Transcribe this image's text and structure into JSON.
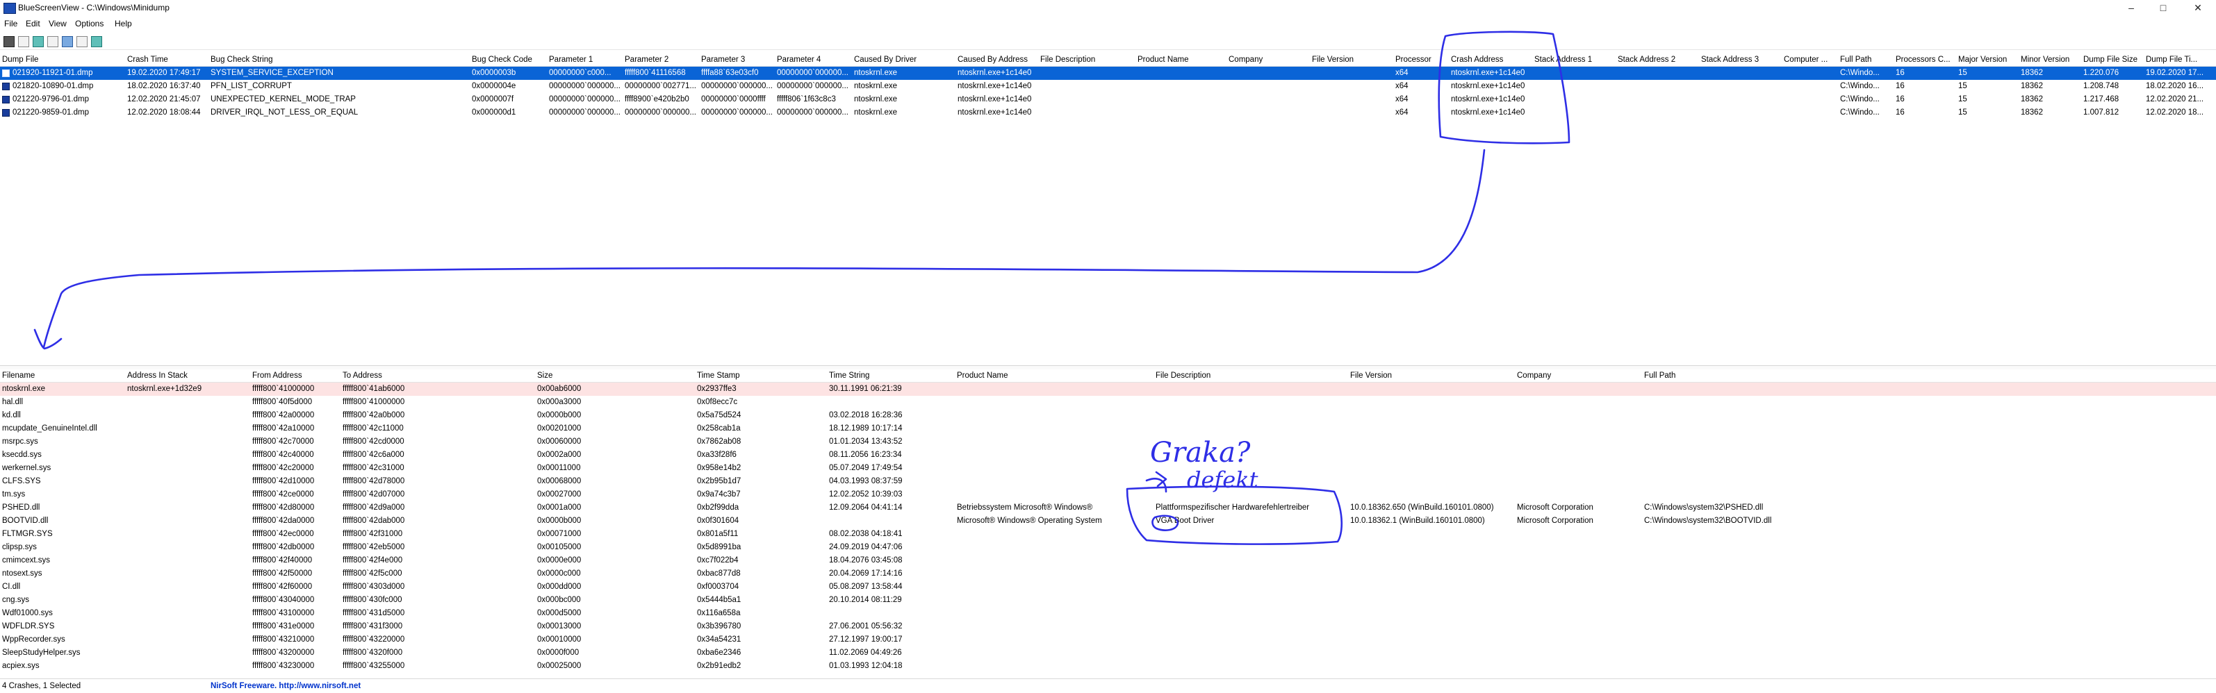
{
  "window": {
    "title": "BlueScreenView  -  C:\\Windows\\Minidump",
    "app_icon": "bluescreen-app-icon"
  },
  "menu": [
    "File",
    "Edit",
    "View",
    "Options",
    "Help"
  ],
  "toolbar_icons": [
    "save-icon",
    "properties-icon",
    "refresh-icon",
    "copy-icon",
    "html-report-icon",
    "find-icon",
    "exit-icon"
  ],
  "crash_table": {
    "headers": [
      "Dump File",
      "Crash Time",
      "Bug Check String",
      "Bug Check Code",
      "Parameter 1",
      "Parameter 2",
      "Parameter 3",
      "Parameter 4",
      "Caused By Driver",
      "Caused By Address",
      "File Description",
      "Product Name",
      "Company",
      "File Version",
      "Processor",
      "Crash Address",
      "Stack Address 1",
      "Stack Address 2",
      "Stack Address 3",
      "Computer ...",
      "Full Path",
      "Processors C...",
      "Major Version",
      "Minor Version",
      "Dump File Size",
      "Dump File Ti..."
    ],
    "rows": [
      [
        "021920-11921-01.dmp",
        "19.02.2020 17:49:17",
        "SYSTEM_SERVICE_EXCEPTION",
        "0x0000003b",
        "00000000`c000...",
        "fffff800`41116568",
        "ffffa88`63e03cf0",
        "00000000`000000...",
        "ntoskrnl.exe",
        "ntoskrnl.exe+1c14e0",
        "",
        "",
        "",
        "",
        "x64",
        "ntoskrnl.exe+1c14e0",
        "",
        "",
        "",
        "",
        "C:\\Windo...",
        "16",
        "15",
        "18362",
        "1.220.076",
        "19.02.2020 17..."
      ],
      [
        "021820-10890-01.dmp",
        "18.02.2020 16:37:40",
        "PFN_LIST_CORRUPT",
        "0x0000004e",
        "00000000`000000...",
        "00000000`002771...",
        "00000000`000000...",
        "00000000`000000...",
        "ntoskrnl.exe",
        "ntoskrnl.exe+1c14e0",
        "",
        "",
        "",
        "",
        "x64",
        "ntoskrnl.exe+1c14e0",
        "",
        "",
        "",
        "",
        "C:\\Windo...",
        "16",
        "15",
        "18362",
        "1.208.748",
        "18.02.2020 16..."
      ],
      [
        "021220-9796-01.dmp",
        "12.02.2020 21:45:07",
        "UNEXPECTED_KERNEL_MODE_TRAP",
        "0x0000007f",
        "00000000`000000...",
        "ffff8900`e420b2b0",
        "00000000`0000ffff",
        "fffff806`1f63c8c3",
        "ntoskrnl.exe",
        "ntoskrnl.exe+1c14e0",
        "",
        "",
        "",
        "",
        "x64",
        "ntoskrnl.exe+1c14e0",
        "",
        "",
        "",
        "",
        "C:\\Windo...",
        "16",
        "15",
        "18362",
        "1.217.468",
        "12.02.2020 21..."
      ],
      [
        "021220-9859-01.dmp",
        "12.02.2020 18:08:44",
        "DRIVER_IRQL_NOT_LESS_OR_EQUAL",
        "0x000000d1",
        "00000000`000000...",
        "00000000`000000...",
        "00000000`000000...",
        "00000000`000000...",
        "ntoskrnl.exe",
        "ntoskrnl.exe+1c14e0",
        "",
        "",
        "",
        "",
        "x64",
        "ntoskrnl.exe+1c14e0",
        "",
        "",
        "",
        "",
        "C:\\Windo...",
        "16",
        "15",
        "18362",
        "1.007.812",
        "12.02.2020 18..."
      ]
    ]
  },
  "driver_table": {
    "headers": [
      "Filename",
      "Address In Stack",
      "From Address",
      "To Address",
      "Size",
      "Time Stamp",
      "Time String",
      "Product Name",
      "File Description",
      "File Version",
      "Company",
      "Full Path"
    ],
    "rows": [
      [
        "ntoskrnl.exe",
        "ntoskrnl.exe+1d32e9",
        "fffff800`41000000",
        "fffff800`41ab6000",
        "0x00ab6000",
        "0x2937ffe3",
        "30.11.1991 06:21:39",
        "",
        "",
        "",
        "",
        ""
      ],
      [
        "hal.dll",
        "",
        "fffff800`40f5d000",
        "fffff800`41000000",
        "0x000a3000",
        "0x0f8ecc7c",
        "",
        "",
        "",
        "",
        "",
        ""
      ],
      [
        "kd.dll",
        "",
        "fffff800`42a00000",
        "fffff800`42a0b000",
        "0x0000b000",
        "0x5a75d524",
        "03.02.2018 16:28:36",
        "",
        "",
        "",
        "",
        ""
      ],
      [
        "mcupdate_GenuineIntel.dll",
        "",
        "fffff800`42a10000",
        "fffff800`42c11000",
        "0x00201000",
        "0x258cab1a",
        "18.12.1989 10:17:14",
        "",
        "",
        "",
        "",
        ""
      ],
      [
        "msrpc.sys",
        "",
        "fffff800`42c70000",
        "fffff800`42cd0000",
        "0x00060000",
        "0x7862ab08",
        "01.01.2034 13:43:52",
        "",
        "",
        "",
        "",
        ""
      ],
      [
        "ksecdd.sys",
        "",
        "fffff800`42c40000",
        "fffff800`42c6a000",
        "0x0002a000",
        "0xa33f28f6",
        "08.11.2056 16:23:34",
        "",
        "",
        "",
        "",
        ""
      ],
      [
        "werkernel.sys",
        "",
        "fffff800`42c20000",
        "fffff800`42c31000",
        "0x00011000",
        "0x958e14b2",
        "05.07.2049 17:49:54",
        "",
        "",
        "",
        "",
        ""
      ],
      [
        "CLFS.SYS",
        "",
        "fffff800`42d10000",
        "fffff800`42d78000",
        "0x00068000",
        "0x2b95b1d7",
        "04.03.1993 08:37:59",
        "",
        "",
        "",
        "",
        ""
      ],
      [
        "tm.sys",
        "",
        "fffff800`42ce0000",
        "fffff800`42d07000",
        "0x00027000",
        "0x9a74c3b7",
        "12.02.2052 10:39:03",
        "",
        "",
        "",
        "",
        ""
      ],
      [
        "PSHED.dll",
        "",
        "fffff800`42d80000",
        "fffff800`42d9a000",
        "0x0001a000",
        "0xb2f99dda",
        "12.09.2064 04:41:14",
        "Betriebssystem Microsoft® Windows®",
        "Plattformspezifischer Hardwarefehlertreiber",
        "10.0.18362.650 (WinBuild.160101.0800)",
        "Microsoft Corporation",
        "C:\\Windows\\system32\\PSHED.dll"
      ],
      [
        "BOOTVID.dll",
        "",
        "fffff800`42da0000",
        "fffff800`42dab000",
        "0x0000b000",
        "0x0f301604",
        "",
        "Microsoft® Windows® Operating System",
        "VGA Boot Driver",
        "10.0.18362.1 (WinBuild.160101.0800)",
        "Microsoft Corporation",
        "C:\\Windows\\system32\\BOOTVID.dll"
      ],
      [
        "FLTMGR.SYS",
        "",
        "fffff800`42ec0000",
        "fffff800`42f31000",
        "0x00071000",
        "0x801a5f11",
        "08.02.2038 04:18:41",
        "",
        "",
        "",
        "",
        ""
      ],
      [
        "clipsp.sys",
        "",
        "fffff800`42db0000",
        "fffff800`42eb5000",
        "0x00105000",
        "0x5d8991ba",
        "24.09.2019 04:47:06",
        "",
        "",
        "",
        "",
        ""
      ],
      [
        "cmimcext.sys",
        "",
        "fffff800`42f40000",
        "fffff800`42f4e000",
        "0x0000e000",
        "0xc7f022b4",
        "18.04.2076 03:45:08",
        "",
        "",
        "",
        "",
        ""
      ],
      [
        "ntosext.sys",
        "",
        "fffff800`42f50000",
        "fffff800`42f5c000",
        "0x0000c000",
        "0xbac877d8",
        "20.04.2069 17:14:16",
        "",
        "",
        "",
        "",
        ""
      ],
      [
        "CI.dll",
        "",
        "fffff800`42f60000",
        "fffff800`4303d000",
        "0x000dd000",
        "0xf0003704",
        "05.08.2097 13:58:44",
        "",
        "",
        "",
        "",
        ""
      ],
      [
        "cng.sys",
        "",
        "fffff800`43040000",
        "fffff800`430fc000",
        "0x000bc000",
        "0x5444b5a1",
        "20.10.2014 08:11:29",
        "",
        "",
        "",
        "",
        ""
      ],
      [
        "Wdf01000.sys",
        "",
        "fffff800`43100000",
        "fffff800`431d5000",
        "0x000d5000",
        "0x116a658a",
        "",
        "",
        "",
        "",
        "",
        ""
      ],
      [
        "WDFLDR.SYS",
        "",
        "fffff800`431e0000",
        "fffff800`431f3000",
        "0x00013000",
        "0x3b396780",
        "27.06.2001 05:56:32",
        "",
        "",
        "",
        "",
        ""
      ],
      [
        "WppRecorder.sys",
        "",
        "fffff800`43210000",
        "fffff800`43220000",
        "0x00010000",
        "0x34a54231",
        "27.12.1997 19:00:17",
        "",
        "",
        "",
        "",
        ""
      ],
      [
        "SleepStudyHelper.sys",
        "",
        "fffff800`43200000",
        "fffff800`4320f000",
        "0x0000f000",
        "0xba6e2346",
        "11.02.2069 04:49:26",
        "",
        "",
        "",
        "",
        ""
      ],
      [
        "acpiex.sys",
        "",
        "fffff800`43230000",
        "fffff800`43255000",
        "0x00025000",
        "0x2b91edb2",
        "01.03.1993 12:04:18",
        "",
        "",
        "",
        "",
        ""
      ]
    ]
  },
  "status": {
    "left": "4 Crashes, 1 Selected",
    "center": "NirSoft Freeware.  http://www.nirsoft.net"
  },
  "annotation": {
    "text_line1": "Graka?",
    "text_line2": "defekt",
    "ink_color": "#2e2ee6"
  },
  "colors": {
    "selection": "#0a64d6",
    "highlight": "#fde3e3",
    "link": "#0033cc"
  }
}
